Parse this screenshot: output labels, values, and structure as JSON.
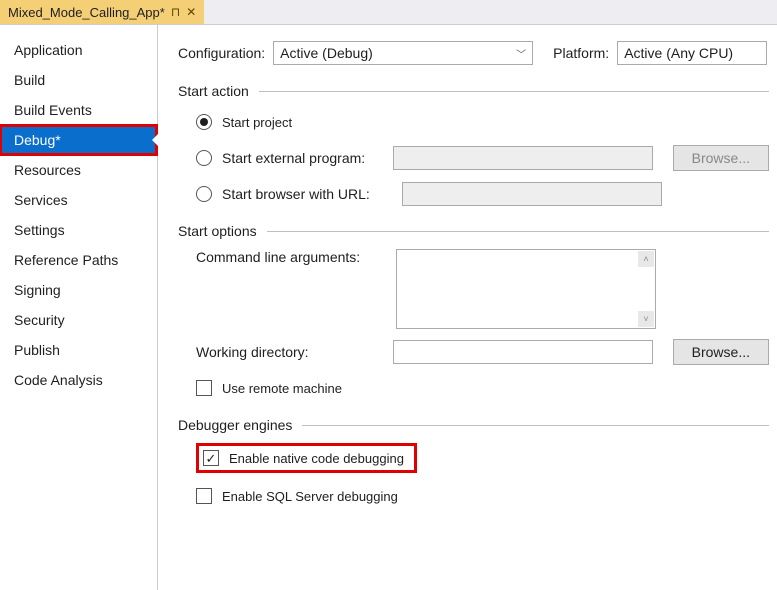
{
  "tab": {
    "title": "Mixed_Mode_Calling_App*"
  },
  "sidebar": {
    "items": [
      {
        "label": "Application"
      },
      {
        "label": "Build"
      },
      {
        "label": "Build Events"
      },
      {
        "label": "Debug*"
      },
      {
        "label": "Resources"
      },
      {
        "label": "Services"
      },
      {
        "label": "Settings"
      },
      {
        "label": "Reference Paths"
      },
      {
        "label": "Signing"
      },
      {
        "label": "Security"
      },
      {
        "label": "Publish"
      },
      {
        "label": "Code Analysis"
      }
    ]
  },
  "top": {
    "configuration_label": "Configuration:",
    "configuration_value": "Active (Debug)",
    "platform_label": "Platform:",
    "platform_value": "Active (Any CPU)"
  },
  "start_action": {
    "header": "Start action",
    "start_project": "Start project",
    "start_external": "Start external program:",
    "start_browser": "Start browser with URL:",
    "browse": "Browse..."
  },
  "start_options": {
    "header": "Start options",
    "cmd_args": "Command line arguments:",
    "work_dir": "Working directory:",
    "browse": "Browse...",
    "remote": "Use remote machine"
  },
  "debugger": {
    "header": "Debugger engines",
    "native": "Enable native code debugging",
    "sql": "Enable SQL Server debugging"
  }
}
